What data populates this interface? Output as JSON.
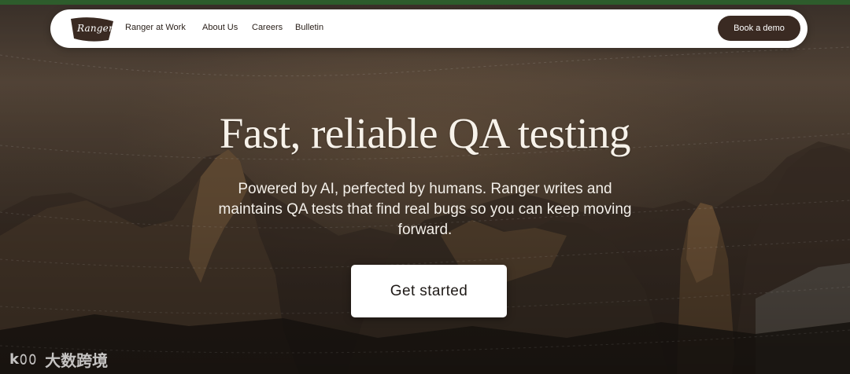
{
  "nav": {
    "logo_text": "Ranger",
    "links": [
      {
        "label": "Ranger at Work"
      },
      {
        "label": "About Us"
      },
      {
        "label": "Careers"
      },
      {
        "label": "Bulletin"
      }
    ],
    "cta_label": "Book a demo"
  },
  "hero": {
    "headline": "Fast, reliable QA testing",
    "subtext": "Powered by AI, perfected by humans. Ranger writes and maintains QA tests that find real bugs so you can keep moving forward.",
    "cta_label": "Get started"
  },
  "watermark": {
    "logo": "k𝟶𝟶",
    "text": "大数跨境"
  },
  "colors": {
    "nav_button_bg": "#3a2a22",
    "logo_badge_bg": "#3a2a22",
    "headline": "#f7f2ea",
    "accent_topline": "#2e6a2f"
  }
}
